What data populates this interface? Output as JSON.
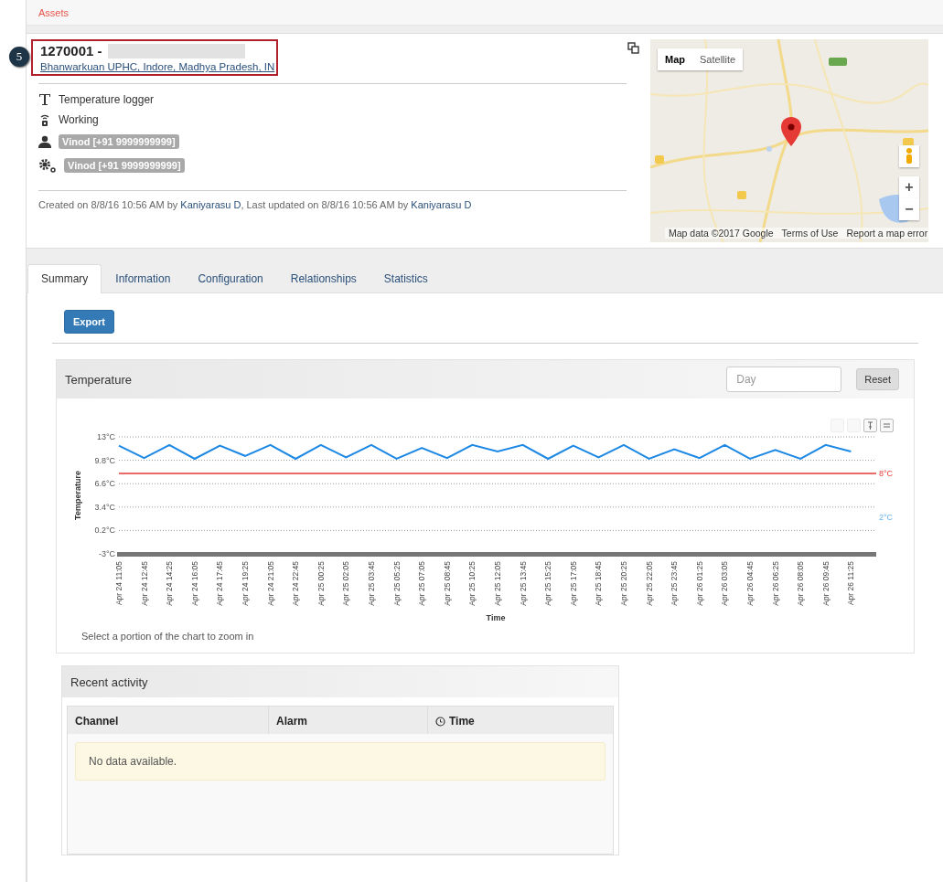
{
  "breadcrumb": [
    {
      "label": "Assets"
    }
  ],
  "callout": {
    "number": "5"
  },
  "asset": {
    "title": "1270001 -",
    "name_redacted": true,
    "location": "Bhanwarkuan UPHC, Indore, Madhya Pradesh, IN"
  },
  "details": [
    {
      "kind": "type",
      "text": "Temperature logger"
    },
    {
      "kind": "status",
      "text": "Working"
    },
    {
      "kind": "owner",
      "badge": "Vinod [+91 9999999999]"
    },
    {
      "kind": "maintainer",
      "badge": "Vinod [+91 9999999999]"
    }
  ],
  "audit": {
    "created": "Created on 8/8/16 10:56 AM by",
    "created_by": "Kaniyarasu D",
    "updated": ", Last updated on 8/8/16 10:56 AM by",
    "updated_by": "Kaniyarasu D"
  },
  "map": {
    "kind": "picture",
    "types": [
      {
        "label": "Map",
        "selected": true
      },
      {
        "label": "Satellite",
        "selected": false
      }
    ],
    "zoom_in": "+",
    "zoom_out": "−",
    "attribution": [
      "Map data ©2017 Google",
      "Terms of Use",
      "Report a map error"
    ]
  },
  "tabs": [
    {
      "label": "Summary",
      "selected": true
    },
    {
      "label": "Information",
      "selected": false
    },
    {
      "label": "Configuration",
      "selected": false
    },
    {
      "label": "Relationships",
      "selected": false
    },
    {
      "label": "Statistics",
      "selected": false
    }
  ],
  "export_button": "Export",
  "temperature_panel": {
    "title": "Temperature",
    "filter": {
      "placeholder": "Day"
    },
    "reset_button": "Reset",
    "hint": "Select a portion of the chart to zoom in",
    "chart_data": {
      "type": "line",
      "xlabel": "Time",
      "ylabel": "Temperature",
      "categories": [
        "Apr 24 11:05",
        "Apr 24 12:45",
        "Apr 24 14:25",
        "Apr 24 16:05",
        "Apr 24 17:45",
        "Apr 24 19:25",
        "Apr 24 21:05",
        "Apr 24 22:45",
        "Apr 25 00:25",
        "Apr 25 02:05",
        "Apr 25 03:45",
        "Apr 25 05:25",
        "Apr 25 07:05",
        "Apr 25 08:45",
        "Apr 25 10:25",
        "Apr 25 12:05",
        "Apr 25 13:45",
        "Apr 25 15:25",
        "Apr 25 17:05",
        "Apr 25 18:45",
        "Apr 25 20:25",
        "Apr 25 22:05",
        "Apr 25 23:45",
        "Apr 26 01:25",
        "Apr 26 03:05",
        "Apr 26 04:45",
        "Apr 26 06:25",
        "Apr 26 08:05",
        "Apr 26 09:45",
        "Apr 26 11:25"
      ],
      "series": [
        {
          "color": "#1e88e5",
          "values": [
            11.8,
            10.1,
            11.9,
            10.0,
            11.8,
            10.4,
            11.9,
            10.0,
            11.9,
            10.2,
            11.9,
            10.0,
            11.5,
            10.1,
            11.9,
            11.0,
            11.9,
            10.0,
            11.8,
            10.2,
            11.9,
            10.0,
            11.3,
            10.1,
            11.9,
            10.0,
            11.2,
            10.0,
            11.9,
            11.0
          ]
        }
      ],
      "ylim": [
        -3,
        13
      ],
      "yticks": [
        {
          "value": 13,
          "label": "13°C"
        },
        {
          "value": 9.8,
          "label": "9.8°C"
        },
        {
          "value": 6.6,
          "label": "6.6°C"
        },
        {
          "value": 3.4,
          "label": "3.4°C"
        },
        {
          "value": 0.2,
          "label": "0.2°C"
        },
        {
          "value": -3,
          "label": "-3°C"
        }
      ],
      "grid": true,
      "ref_lines": [
        {
          "axis": "y",
          "value": 8,
          "label": "8°C",
          "color": "#e53935"
        }
      ],
      "annotations": [
        "2°C"
      ]
    }
  },
  "activity_panel": {
    "title": "Recent activity",
    "columns": [
      {
        "label": "Channel",
        "icon": false
      },
      {
        "label": "Alarm",
        "icon": false
      },
      {
        "label": "Time",
        "icon": true
      }
    ],
    "empty_message": "No data available."
  }
}
